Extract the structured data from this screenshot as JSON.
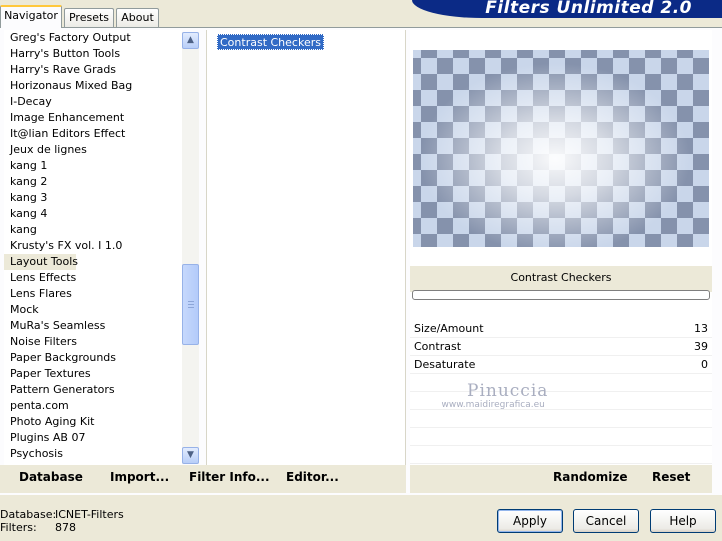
{
  "window": {
    "banner_title": "Filters Unlimited 2.0"
  },
  "tabs": [
    {
      "label": "Navigator",
      "active": true
    },
    {
      "label": "Presets",
      "active": false
    },
    {
      "label": "About",
      "active": false
    }
  ],
  "categories": {
    "selected_index": 14,
    "items": [
      "Greg's Factory Output",
      "Harry's Button Tools",
      "Harry's Rave Grads",
      "Horizonaus Mixed Bag",
      "I-Decay",
      "Image Enhancement",
      "It@lian Editors Effect",
      "Jeux de lignes",
      "kang 1",
      "kang 2",
      "kang 3",
      "kang 4",
      "kang",
      "Krusty's FX vol. I 1.0",
      "Layout Tools",
      "Lens Effects",
      "Lens Flares",
      "Mock",
      "MuRa's Seamless",
      "Noise Filters",
      "Paper Backgrounds",
      "Paper Textures",
      "Pattern Generators",
      "penta.com",
      "Photo Aging Kit",
      "Plugins AB 07",
      "Psychosis"
    ]
  },
  "filters": {
    "selected": "Contrast Checkers"
  },
  "preview": {
    "filter_name": "Contrast Checkers"
  },
  "parameters": [
    {
      "label": "Size/Amount",
      "value": "13"
    },
    {
      "label": "Contrast",
      "value": "39"
    },
    {
      "label": "Desaturate",
      "value": "0"
    }
  ],
  "watermark": {
    "name": "Pinuccia",
    "url": "www.maidiregrafica.eu"
  },
  "toolbar": {
    "database": "Database",
    "import": "Import...",
    "filter_info": "Filter Info...",
    "editor": "Editor...",
    "randomize": "Randomize",
    "reset": "Reset"
  },
  "status": {
    "database_label": "Database:",
    "database_value": "ICNET-Filters",
    "filters_label": "Filters:",
    "filters_value": "878"
  },
  "buttons": {
    "apply": "Apply",
    "cancel": "Cancel",
    "help": "Help"
  }
}
